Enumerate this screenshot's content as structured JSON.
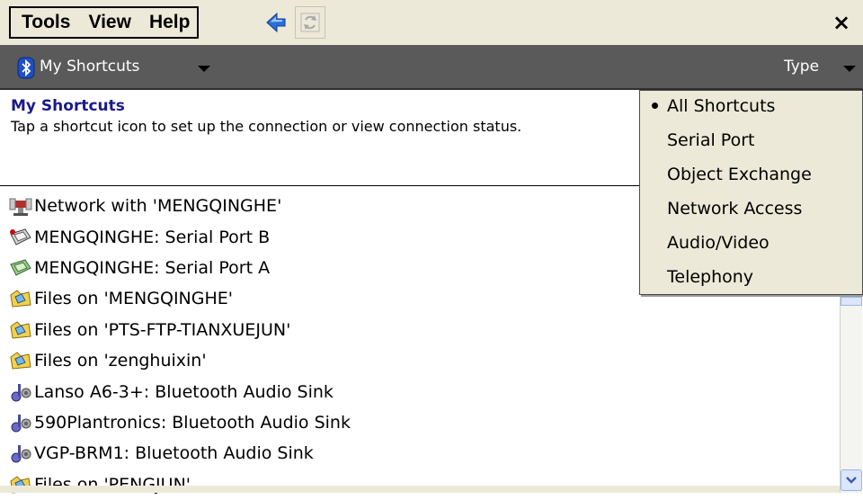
{
  "menubar": {
    "menus": [
      "Tools",
      "View",
      "Help"
    ],
    "close_label": "×"
  },
  "filterbar": {
    "shortcut_filter": "My Shortcuts",
    "type_filter": "Type"
  },
  "header": {
    "title": "My Shortcuts",
    "description": "Tap a shortcut icon to set up the connection or view connection status."
  },
  "shortcuts": [
    {
      "label": "Network with 'MENGQINGHE'",
      "icon": "network-icon"
    },
    {
      "label": "MENGQINGHE: Serial Port B",
      "icon": "serial-port-icon"
    },
    {
      "label": "MENGQINGHE: Serial Port A",
      "icon": "serial-port-active-icon"
    },
    {
      "label": "Files on 'MENGQINGHE'",
      "icon": "folder-icon"
    },
    {
      "label": "Files on 'PTS-FTP-TIANXUEJUN'",
      "icon": "folder-icon"
    },
    {
      "label": "Files on 'zenghuixin'",
      "icon": "folder-icon"
    },
    {
      "label": "Lanso A6-3+: Bluetooth Audio Sink",
      "icon": "audio-icon"
    },
    {
      "label": "590Plantronics: Bluetooth Audio Sink",
      "icon": "audio-icon"
    },
    {
      "label": "VGP-BRM1: Bluetooth Audio Sink",
      "icon": "audio-icon"
    },
    {
      "label": "Files on 'PENGJUN'",
      "icon": "folder-icon"
    }
  ],
  "type_menu": {
    "options": [
      "All Shortcuts",
      "Serial Port",
      "Object Exchange",
      "Network Access",
      "Audio/Video",
      "Telephony"
    ],
    "selected": "All Shortcuts"
  },
  "colors": {
    "title_blue": "#1a1a8c",
    "filterbar_bg": "#5a5a5a",
    "menubar_bg": "#ece9d8"
  }
}
